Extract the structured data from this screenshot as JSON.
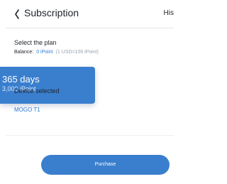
{
  "header": {
    "title": "Subscription",
    "right_label": "His"
  },
  "plan": {
    "section_title": "Select the plan",
    "balance_label": "Balance:",
    "balance_value": "0 iPoint",
    "balance_note": "(1 USD=100 iPoint)"
  },
  "selected_plan": {
    "duration": "365 days",
    "price": "3,000 iPoint"
  },
  "device": {
    "label": "Device selected",
    "name": "MOGO T1"
  },
  "actions": {
    "purchase_label": "Purchase"
  },
  "colors": {
    "accent": "#3a7fce",
    "link": "#2f7cd6",
    "text": "#1f2329",
    "muted": "#9aa3ad"
  },
  "icons": {
    "back": "chevron-left-icon"
  }
}
